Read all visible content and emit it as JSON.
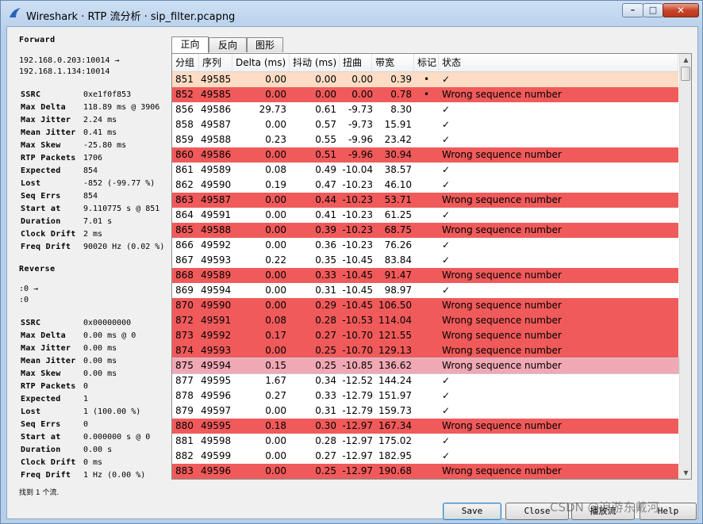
{
  "window": {
    "title": "Wireshark · RTP 流分析 · sip_filter.pcapng",
    "btn_min": "–",
    "btn_max": "□",
    "btn_close": "✕"
  },
  "forward": {
    "heading": "Forward",
    "addr_line1": "192.168.0.203:10014 →",
    "addr_line2": "192.168.1.134:10014",
    "stats": [
      {
        "k": "SSRC",
        "v": "0xe1f0f853"
      },
      {
        "k": "Max Delta",
        "v": "118.89 ms @ 3906"
      },
      {
        "k": "Max Jitter",
        "v": "2.24 ms"
      },
      {
        "k": "Mean Jitter",
        "v": "0.41 ms"
      },
      {
        "k": "Max Skew",
        "v": "-25.80 ms"
      },
      {
        "k": "RTP Packets",
        "v": "1706"
      },
      {
        "k": "Expected",
        "v": "854"
      },
      {
        "k": "Lost",
        "v": "-852 (-99.77 %)"
      },
      {
        "k": "Seq Errs",
        "v": "854"
      },
      {
        "k": "Start at",
        "v": "9.110775 s @ 851"
      },
      {
        "k": "Duration",
        "v": "7.01 s"
      },
      {
        "k": "Clock Drift",
        "v": "2 ms"
      },
      {
        "k": "Freq Drift",
        "v": "90020 Hz (0.02 %)"
      }
    ]
  },
  "reverse": {
    "heading": "Reverse",
    "addr_line1": ":0 →",
    "addr_line2": ":0",
    "stats": [
      {
        "k": "SSRC",
        "v": "0x00000000"
      },
      {
        "k": "Max Delta",
        "v": "0.00 ms @ 0"
      },
      {
        "k": "Max Jitter",
        "v": "0.00 ms"
      },
      {
        "k": "Mean Jitter",
        "v": "0.00 ms"
      },
      {
        "k": "Max Skew",
        "v": "0.00 ms"
      },
      {
        "k": "RTP Packets",
        "v": "0"
      },
      {
        "k": "Expected",
        "v": "1"
      },
      {
        "k": "Lost",
        "v": "1 (100.00 %)"
      },
      {
        "k": "Seq Errs",
        "v": "0"
      },
      {
        "k": "Start at",
        "v": "0.000000 s @ 0"
      },
      {
        "k": "Duration",
        "v": "0.00 s"
      },
      {
        "k": "Clock Drift",
        "v": "0 ms"
      },
      {
        "k": "Freq Drift",
        "v": "1 Hz (0.00 %)"
      }
    ]
  },
  "found_text": "找到 1 个流.",
  "tabs": [
    "正向",
    "反向",
    "图形"
  ],
  "columns": [
    "分组",
    "序列",
    "Delta (ms)",
    "抖动 (ms)",
    "扭曲",
    "带宽",
    "标记",
    "状态"
  ],
  "rows": [
    {
      "pkt": "851",
      "seq": "49585",
      "delta": "0.00",
      "jitter": "0.00",
      "skew": "0.00",
      "bw": "0.39",
      "mark": "•",
      "status": "✓",
      "kind": "first"
    },
    {
      "pkt": "852",
      "seq": "49585",
      "delta": "0.00",
      "jitter": "0.00",
      "skew": "0.00",
      "bw": "0.78",
      "mark": "•",
      "status": "Wrong sequence number",
      "kind": "err"
    },
    {
      "pkt": "856",
      "seq": "49586",
      "delta": "29.73",
      "jitter": "0.61",
      "skew": "-9.73",
      "bw": "8.30",
      "mark": "",
      "status": "✓",
      "kind": "ok"
    },
    {
      "pkt": "858",
      "seq": "49587",
      "delta": "0.00",
      "jitter": "0.57",
      "skew": "-9.73",
      "bw": "15.91",
      "mark": "",
      "status": "✓",
      "kind": "ok"
    },
    {
      "pkt": "859",
      "seq": "49588",
      "delta": "0.23",
      "jitter": "0.55",
      "skew": "-9.96",
      "bw": "23.42",
      "mark": "",
      "status": "✓",
      "kind": "ok"
    },
    {
      "pkt": "860",
      "seq": "49586",
      "delta": "0.00",
      "jitter": "0.51",
      "skew": "-9.96",
      "bw": "30.94",
      "mark": "",
      "status": "Wrong sequence number",
      "kind": "err"
    },
    {
      "pkt": "861",
      "seq": "49589",
      "delta": "0.08",
      "jitter": "0.49",
      "skew": "-10.04",
      "bw": "38.57",
      "mark": "",
      "status": "✓",
      "kind": "ok"
    },
    {
      "pkt": "862",
      "seq": "49590",
      "delta": "0.19",
      "jitter": "0.47",
      "skew": "-10.23",
      "bw": "46.10",
      "mark": "",
      "status": "✓",
      "kind": "ok"
    },
    {
      "pkt": "863",
      "seq": "49587",
      "delta": "0.00",
      "jitter": "0.44",
      "skew": "-10.23",
      "bw": "53.71",
      "mark": "",
      "status": "Wrong sequence number",
      "kind": "err"
    },
    {
      "pkt": "864",
      "seq": "49591",
      "delta": "0.00",
      "jitter": "0.41",
      "skew": "-10.23",
      "bw": "61.25",
      "mark": "",
      "status": "✓",
      "kind": "ok"
    },
    {
      "pkt": "865",
      "seq": "49588",
      "delta": "0.00",
      "jitter": "0.39",
      "skew": "-10.23",
      "bw": "68.75",
      "mark": "",
      "status": "Wrong sequence number",
      "kind": "err"
    },
    {
      "pkt": "866",
      "seq": "49592",
      "delta": "0.00",
      "jitter": "0.36",
      "skew": "-10.23",
      "bw": "76.26",
      "mark": "",
      "status": "✓",
      "kind": "ok"
    },
    {
      "pkt": "867",
      "seq": "49593",
      "delta": "0.22",
      "jitter": "0.35",
      "skew": "-10.45",
      "bw": "83.84",
      "mark": "",
      "status": "✓",
      "kind": "ok"
    },
    {
      "pkt": "868",
      "seq": "49589",
      "delta": "0.00",
      "jitter": "0.33",
      "skew": "-10.45",
      "bw": "91.47",
      "mark": "",
      "status": "Wrong sequence number",
      "kind": "err"
    },
    {
      "pkt": "869",
      "seq": "49594",
      "delta": "0.00",
      "jitter": "0.31",
      "skew": "-10.45",
      "bw": "98.97",
      "mark": "",
      "status": "✓",
      "kind": "ok"
    },
    {
      "pkt": "870",
      "seq": "49590",
      "delta": "0.00",
      "jitter": "0.29",
      "skew": "-10.45",
      "bw": "106.50",
      "mark": "",
      "status": "Wrong sequence number",
      "kind": "err"
    },
    {
      "pkt": "872",
      "seq": "49591",
      "delta": "0.08",
      "jitter": "0.28",
      "skew": "-10.53",
      "bw": "114.04",
      "mark": "",
      "status": "Wrong sequence number",
      "kind": "err"
    },
    {
      "pkt": "873",
      "seq": "49592",
      "delta": "0.17",
      "jitter": "0.27",
      "skew": "-10.70",
      "bw": "121.55",
      "mark": "",
      "status": "Wrong sequence number",
      "kind": "err"
    },
    {
      "pkt": "874",
      "seq": "49593",
      "delta": "0.00",
      "jitter": "0.25",
      "skew": "-10.70",
      "bw": "129.13",
      "mark": "",
      "status": "Wrong sequence number",
      "kind": "err"
    },
    {
      "pkt": "875",
      "seq": "49594",
      "delta": "0.15",
      "jitter": "0.25",
      "skew": "-10.85",
      "bw": "136.62",
      "mark": "",
      "status": "Wrong sequence number",
      "kind": "sel"
    },
    {
      "pkt": "877",
      "seq": "49595",
      "delta": "1.67",
      "jitter": "0.34",
      "skew": "-12.52",
      "bw": "144.24",
      "mark": "",
      "status": "✓",
      "kind": "ok"
    },
    {
      "pkt": "878",
      "seq": "49596",
      "delta": "0.27",
      "jitter": "0.33",
      "skew": "-12.79",
      "bw": "151.97",
      "mark": "",
      "status": "✓",
      "kind": "ok"
    },
    {
      "pkt": "879",
      "seq": "49597",
      "delta": "0.00",
      "jitter": "0.31",
      "skew": "-12.79",
      "bw": "159.73",
      "mark": "",
      "status": "✓",
      "kind": "ok"
    },
    {
      "pkt": "880",
      "seq": "49595",
      "delta": "0.18",
      "jitter": "0.30",
      "skew": "-12.97",
      "bw": "167.34",
      "mark": "",
      "status": "Wrong sequence number",
      "kind": "err"
    },
    {
      "pkt": "881",
      "seq": "49598",
      "delta": "0.00",
      "jitter": "0.28",
      "skew": "-12.97",
      "bw": "175.02",
      "mark": "",
      "status": "✓",
      "kind": "ok"
    },
    {
      "pkt": "882",
      "seq": "49599",
      "delta": "0.00",
      "jitter": "0.27",
      "skew": "-12.97",
      "bw": "182.95",
      "mark": "",
      "status": "✓",
      "kind": "ok"
    },
    {
      "pkt": "883",
      "seq": "49596",
      "delta": "0.00",
      "jitter": "0.25",
      "skew": "-12.97",
      "bw": "190.68",
      "mark": "",
      "status": "Wrong sequence number",
      "kind": "err"
    }
  ],
  "buttons": {
    "save": "Save",
    "close": "Close",
    "play": "播放流",
    "help": "Help"
  },
  "watermark": "CSDN @浪游东戴河",
  "colors": {
    "error_row": "#f05a5a",
    "first_row": "#fcdcc4",
    "selected_row": "#f0a8b4"
  }
}
